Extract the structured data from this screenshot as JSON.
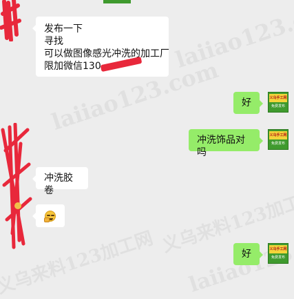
{
  "watermark": {
    "text": "laiiao123.com",
    "text_cn": "义乌来料123加工网"
  },
  "messages": [
    {
      "id": "m1",
      "direction": "incoming",
      "lines": [
        "发布一下",
        "寻找",
        "可以做图像感光冲洗的加工厂",
        "限加微信130"
      ]
    },
    {
      "id": "m2",
      "direction": "outgoing",
      "text": "好"
    },
    {
      "id": "m3",
      "direction": "outgoing",
      "text": "冲洗饰品对吗"
    },
    {
      "id": "m4",
      "direction": "incoming",
      "text": "冲洗胶卷"
    },
    {
      "id": "m5",
      "direction": "incoming",
      "emoji": "face-with-hand-icon"
    },
    {
      "id": "m6",
      "direction": "outgoing",
      "text": "好"
    }
  ],
  "me_avatar": {
    "top_text": "义乌手工网",
    "bottom_text": "免费发布"
  },
  "colors": {
    "background": "#ededed",
    "incoming_bubble": "#ffffff",
    "outgoing_bubble": "#95ec69",
    "redaction": "#e8283b"
  }
}
